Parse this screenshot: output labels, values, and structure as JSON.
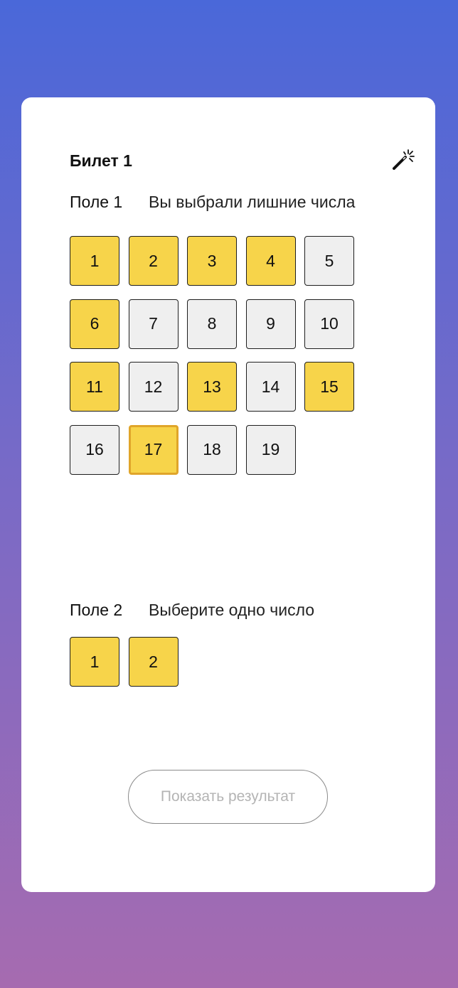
{
  "ticket": {
    "title": "Билет 1",
    "wand_icon": "magic-wand-icon"
  },
  "field1": {
    "label": "Поле 1",
    "hint": "Вы выбрали лишние числа",
    "cells": [
      {
        "number": "1",
        "selected": true
      },
      {
        "number": "2",
        "selected": true
      },
      {
        "number": "3",
        "selected": true
      },
      {
        "number": "4",
        "selected": true
      },
      {
        "number": "5",
        "selected": false
      },
      {
        "number": "6",
        "selected": true
      },
      {
        "number": "7",
        "selected": false
      },
      {
        "number": "8",
        "selected": false
      },
      {
        "number": "9",
        "selected": false
      },
      {
        "number": "10",
        "selected": false
      },
      {
        "number": "11",
        "selected": true
      },
      {
        "number": "12",
        "selected": false
      },
      {
        "number": "13",
        "selected": true
      },
      {
        "number": "14",
        "selected": false
      },
      {
        "number": "15",
        "selected": true
      },
      {
        "number": "16",
        "selected": false
      },
      {
        "number": "17",
        "selected": true,
        "focused": true
      },
      {
        "number": "18",
        "selected": false
      },
      {
        "number": "19",
        "selected": false
      }
    ]
  },
  "field2": {
    "label": "Поле 2",
    "hint": "Выберите одно число",
    "cells": [
      {
        "number": "1",
        "selected": true
      },
      {
        "number": "2",
        "selected": true
      }
    ]
  },
  "actions": {
    "show_result_label": "Показать результат"
  },
  "colors": {
    "selected": "#f7d44a",
    "unselected": "#efefef",
    "focus_border": "#e0a52a",
    "background_top": "#4a68d9",
    "background_bottom": "#a66bb0"
  }
}
